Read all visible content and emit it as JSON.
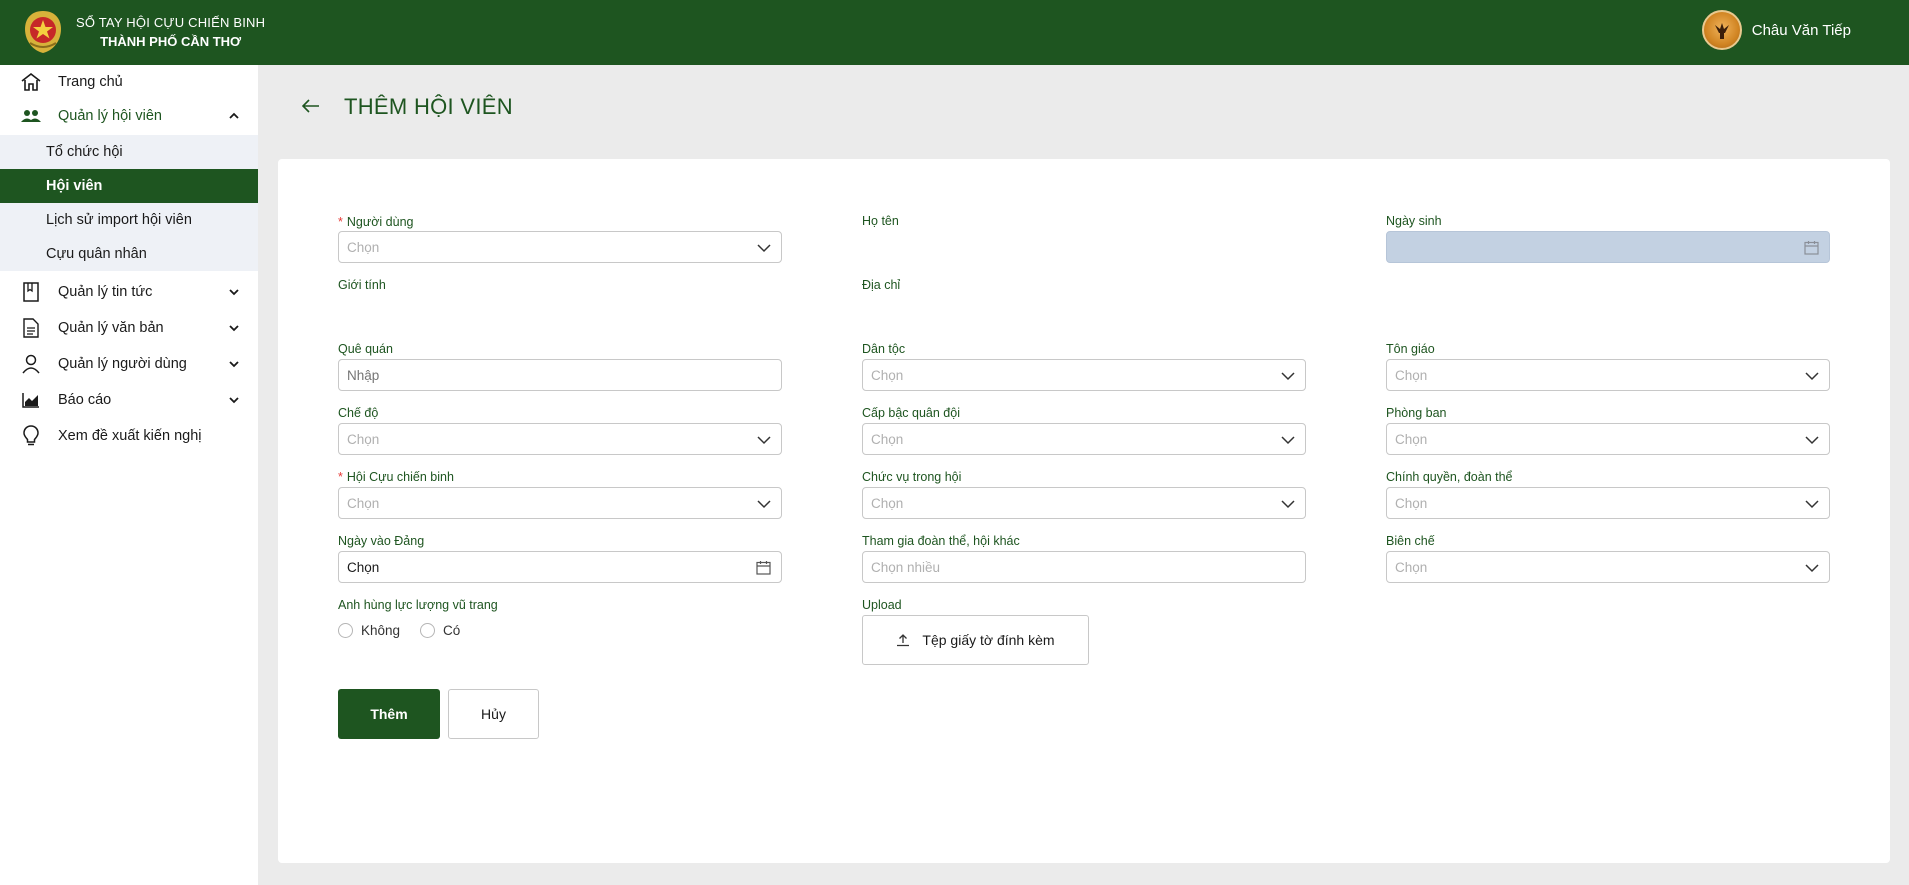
{
  "header": {
    "brand_line1": "SỔ TAY HỘI CỰU CHIẾN BINH",
    "brand_line2": "THÀNH PHỐ CẦN THƠ",
    "user_name": "Châu Văn Tiếp"
  },
  "sidebar": {
    "items": [
      {
        "label": "Trang chủ",
        "icon": "home-icon"
      },
      {
        "label": "Quản lý hội viên",
        "icon": "users-icon",
        "expanded": true
      },
      {
        "label": "Quản lý tin tức",
        "icon": "book-icon"
      },
      {
        "label": "Quản lý văn bản",
        "icon": "document-icon"
      },
      {
        "label": "Quản lý người dùng",
        "icon": "user-icon"
      },
      {
        "label": "Báo cáo",
        "icon": "chart-icon"
      },
      {
        "label": "Xem đề xuất kiến nghị",
        "icon": "lightbulb-icon"
      }
    ],
    "sub_items": [
      {
        "label": "Tổ chức hội"
      },
      {
        "label": "Hội viên",
        "active": true
      },
      {
        "label": "Lịch sử import hội viên"
      },
      {
        "label": "Cựu quân nhân"
      }
    ]
  },
  "page": {
    "title": "THÊM HỘI VIÊN"
  },
  "form": {
    "nguoi_dung": {
      "label": "Người dùng",
      "placeholder": "Chọn"
    },
    "ho_ten": {
      "label": "Họ tên"
    },
    "ngay_sinh": {
      "label": "Ngày sinh"
    },
    "gioi_tinh": {
      "label": "Giới tính"
    },
    "dia_chi": {
      "label": "Địa chỉ"
    },
    "que_quan": {
      "label": "Quê quán",
      "placeholder": "Nhập"
    },
    "dan_toc": {
      "label": "Dân tộc",
      "placeholder": "Chọn"
    },
    "ton_giao": {
      "label": "Tôn giáo",
      "placeholder": "Chọn"
    },
    "che_do": {
      "label": "Chế độ",
      "placeholder": "Chọn"
    },
    "cap_bac": {
      "label": "Cấp bậc quân đội",
      "placeholder": "Chọn"
    },
    "phong_ban": {
      "label": "Phòng ban",
      "placeholder": "Chọn"
    },
    "hoi_ccb": {
      "label": "Hội Cựu chiến binh",
      "placeholder": "Chọn"
    },
    "chuc_vu": {
      "label": "Chức vụ trong hội",
      "placeholder": "Chọn"
    },
    "chinh_quyen": {
      "label": "Chính quyền, đoàn thể",
      "placeholder": "Chọn"
    },
    "ngay_vao_dang": {
      "label": "Ngày vào Đảng",
      "value": "Chọn"
    },
    "tham_gia": {
      "label": "Tham gia đoàn thể, hội khác",
      "placeholder": "Chọn nhiều"
    },
    "bien_che": {
      "label": "Biên chế",
      "placeholder": "Chọn"
    },
    "anh_hung": {
      "label": "Anh hùng lực lượng vũ trang",
      "options": [
        "Không",
        "Có"
      ]
    },
    "upload": {
      "label": "Upload",
      "button": "Tệp giấy tờ đính kèm"
    },
    "submit": "Thêm",
    "cancel": "Hủy"
  },
  "colors": {
    "primary": "#1e5520",
    "required": "#e53935",
    "disabled_bg": "#c3d1e2",
    "sub_bg": "#eef1f6"
  }
}
